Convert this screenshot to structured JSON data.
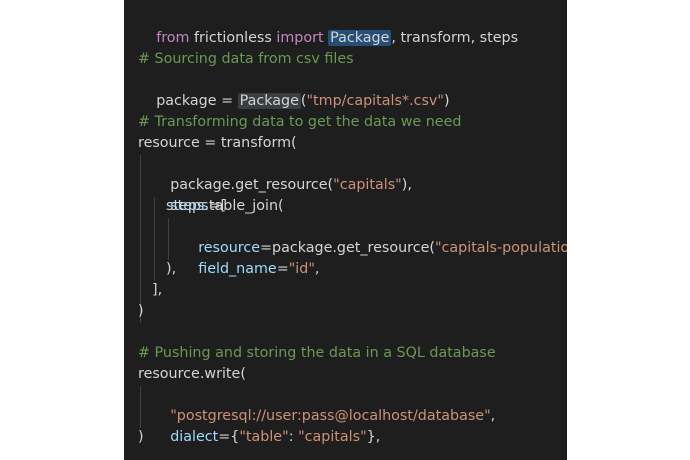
{
  "code": {
    "l1": {
      "from": "from",
      "mod": " frictionless ",
      "import": "import",
      "pkg": "Package",
      "rest": ", transform, steps"
    },
    "l3": {
      "comment": "# Sourcing data from csv files"
    },
    "l4": {
      "pre": "package = ",
      "pkg": "Package",
      "paren": "(",
      "str": "\"tmp/capitals*.csv\"",
      "post": ")"
    },
    "l6": {
      "comment": "# Transforming data to get the data we need"
    },
    "l7": {
      "text": "resource = transform("
    },
    "l8": {
      "pre": "package.get_resource(",
      "str": "\"capitals\"",
      "post": "),"
    },
    "l9": {
      "kw": "steps",
      "post": "=["
    },
    "l10": {
      "text": "steps.table_join("
    },
    "l11": {
      "kw": "resource",
      "pre": "=package.get_resource(",
      "str": "\"capitals-population\"",
      "post": "),"
    },
    "l12": {
      "kw": "field_name",
      "pre": "=",
      "str": "\"id\"",
      "post": ","
    },
    "l13": {
      "text": "),"
    },
    "l14": {
      "text": "],"
    },
    "l15": {
      "text": ")"
    },
    "l17": {
      "comment": "# Pushing and storing the data in a SQL database"
    },
    "l18": {
      "text": "resource.write("
    },
    "l19": {
      "str": "\"postgresql://user:pass@localhost/database\"",
      "post": ","
    },
    "l20": {
      "kw": "dialect",
      "pre": "={",
      "s1": "\"table\"",
      "mid": ": ",
      "s2": "\"capitals\"",
      "post": "},"
    },
    "l21": {
      "text": ")"
    }
  },
  "colors": {
    "background": "#1e1e1e",
    "keyword": "#c586c0",
    "string": "#ce9178",
    "comment": "#6a9955",
    "parameter": "#9cdcfe",
    "text": "#d4d4d4"
  }
}
